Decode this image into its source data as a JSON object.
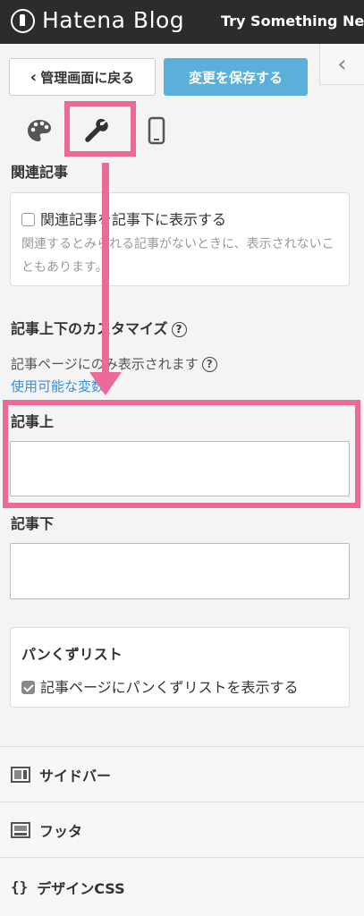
{
  "header": {
    "logo_text": "Hatena Blog",
    "try_text": "Try Something New"
  },
  "toolbar": {
    "back_label": "管理画面に戻る",
    "save_label": "変更を保存する",
    "save_color": "#5ab0d9"
  },
  "tabs": [
    {
      "name": "design",
      "icon": "palette-icon"
    },
    {
      "name": "customize",
      "icon": "wrench-icon"
    },
    {
      "name": "smartphone",
      "icon": "smartphone-icon"
    }
  ],
  "related": {
    "heading": "関連記事",
    "checkbox_label": "関連記事を記事下に表示する",
    "checked": false,
    "note": "関連するとみられる記事がないときに、表示されないこともあります。"
  },
  "customize": {
    "title": "記事上下のカスタマイズ",
    "note": "記事ページにのみ表示されます",
    "vars_link": "使用可能な変数",
    "top_label": "記事上",
    "top_value": "",
    "bottom_label": "記事下",
    "bottom_value": ""
  },
  "breadcrumb": {
    "title": "パンくずリスト",
    "checkbox_label": "記事ページにパンくずリストを表示する",
    "checked": true
  },
  "menu": {
    "sidebar": "サイドバー",
    "footer": "フッタ",
    "css": "デザインCSS",
    "css_icon_text": "{}"
  },
  "annotation_color": "#ec6a9a"
}
